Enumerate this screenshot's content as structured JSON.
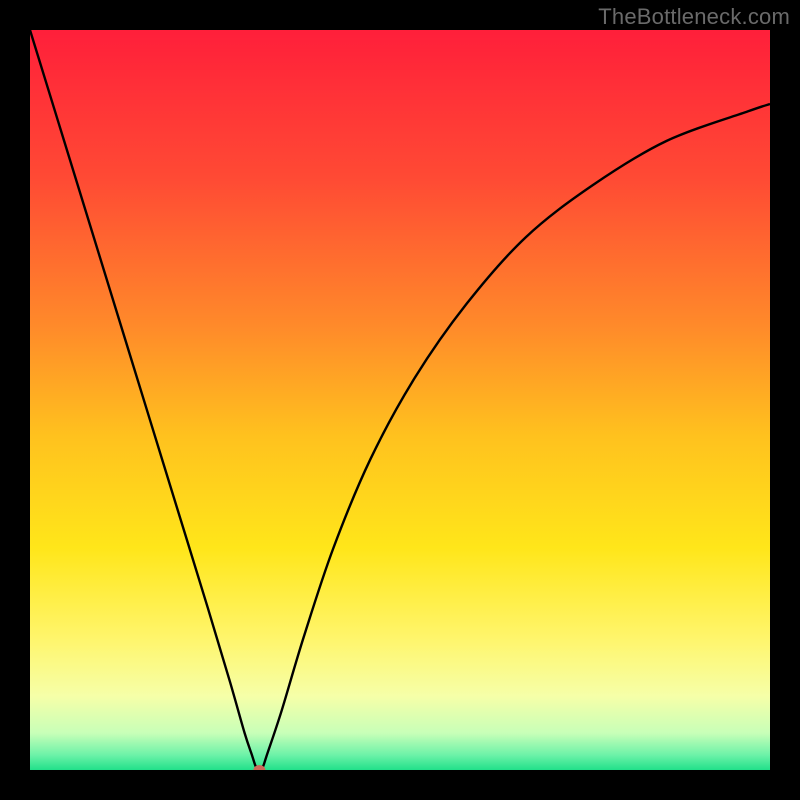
{
  "watermark": "TheBottleneck.com",
  "chart_data": {
    "type": "line",
    "title": "",
    "xlabel": "",
    "ylabel": "",
    "xlim": [
      0,
      100
    ],
    "ylim": [
      0,
      100
    ],
    "grid": false,
    "legend": false,
    "annotations": [],
    "background": {
      "type": "vertical_gradient",
      "stops": [
        {
          "pos": 0.0,
          "color": "#ff1f3a"
        },
        {
          "pos": 0.2,
          "color": "#ff4a34"
        },
        {
          "pos": 0.4,
          "color": "#ff8a2a"
        },
        {
          "pos": 0.55,
          "color": "#ffc21e"
        },
        {
          "pos": 0.7,
          "color": "#ffe61a"
        },
        {
          "pos": 0.82,
          "color": "#fff56a"
        },
        {
          "pos": 0.9,
          "color": "#f6ffa8"
        },
        {
          "pos": 0.95,
          "color": "#c8ffb8"
        },
        {
          "pos": 0.98,
          "color": "#6cf2a8"
        },
        {
          "pos": 1.0,
          "color": "#22e08a"
        }
      ]
    },
    "series": [
      {
        "name": "bottleneck-curve",
        "color": "#000000",
        "x": [
          0,
          4,
          8,
          12,
          16,
          20,
          24,
          27,
          29,
          30,
          30.5,
          31,
          31.5,
          32,
          34,
          37,
          41,
          46,
          52,
          59,
          67,
          76,
          86,
          97,
          100
        ],
        "y": [
          100,
          87,
          74,
          61,
          48,
          35,
          22,
          12,
          5,
          2,
          0.5,
          0,
          0.5,
          2,
          8,
          18,
          30,
          42,
          53,
          63,
          72,
          79,
          85,
          89,
          90
        ]
      }
    ],
    "marker": {
      "name": "low-point-marker",
      "x": 31,
      "y": 0,
      "color": "#cc6a5a",
      "rx": 6,
      "ry": 5
    }
  }
}
